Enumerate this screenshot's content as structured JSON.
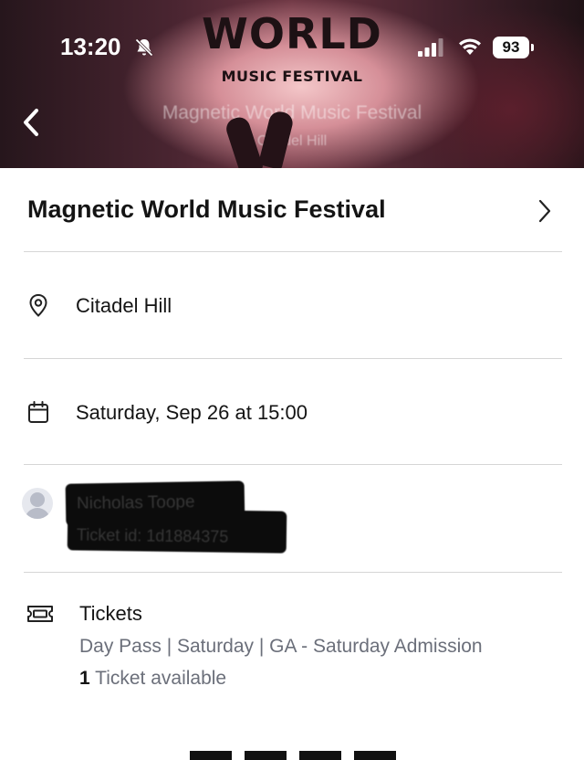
{
  "status_bar": {
    "time": "13:20",
    "battery": "93"
  },
  "hero": {
    "wordmark": "WORLD",
    "subtitle": "MUSIC FESTIVAL",
    "title": "Magnetic World Music Festival",
    "venue": "Citadel Hill"
  },
  "event": {
    "title": "Magnetic World Music Festival",
    "location": "Citadel Hill",
    "datetime": "Saturday, Sep 26 at 15:00"
  },
  "attendee": {
    "name": "Nicholas Toope",
    "ticket_id": "Ticket id: 1d1884375"
  },
  "tickets": {
    "heading": "Tickets",
    "detail": "Day Pass | Saturday | GA - Saturday Admission",
    "available_count": "1",
    "available_label": " Ticket available"
  },
  "icons": {
    "back": "chevron-left-icon",
    "chevron": "chevron-right-icon",
    "location": "location-pin-icon",
    "calendar": "calendar-icon",
    "avatar": "user-avatar-icon",
    "ticket": "ticket-icon",
    "bell_muted": "bell-slash-icon",
    "signal": "cellular-signal-icon",
    "wifi": "wifi-icon"
  },
  "colors": {
    "text": "#141414",
    "muted_text": "#6b6f7a",
    "divider": "#d6d6d6"
  }
}
